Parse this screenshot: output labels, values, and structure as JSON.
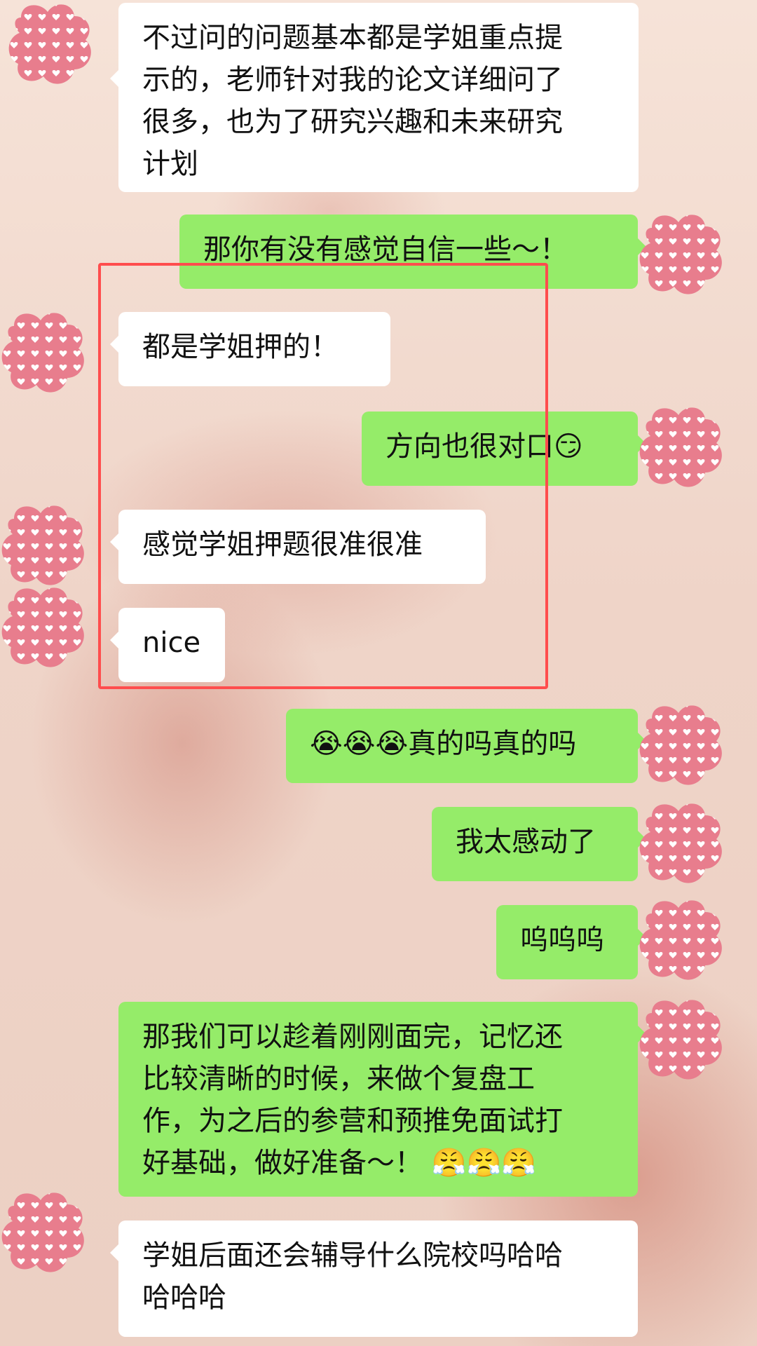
{
  "chat": {
    "messages": [
      {
        "side": "left",
        "lines": [
          "不过问的问题基本都是学姐重点提",
          "示的，老师针对我的论文详细问了",
          "很多，也为了研究兴趣和未来研究",
          "计划"
        ]
      },
      {
        "side": "right",
        "lines": [
          "那你有没有感觉自信一些～！"
        ]
      },
      {
        "side": "left",
        "lines": [
          "都是学姐押的！"
        ]
      },
      {
        "side": "right",
        "lines": [
          "方向也很对口😏"
        ]
      },
      {
        "side": "left",
        "lines": [
          "感觉学姐押题很准很准"
        ]
      },
      {
        "side": "left",
        "lines": [
          "nice"
        ]
      },
      {
        "side": "right",
        "lines": [
          "😭😭😭真的吗真的吗"
        ]
      },
      {
        "side": "right",
        "lines": [
          "我太感动了"
        ]
      },
      {
        "side": "right",
        "lines": [
          "呜呜呜"
        ]
      },
      {
        "side": "right",
        "lines": [
          "那我们可以趁着刚刚面完，记忆还",
          "比较清晰的时候，来做个复盘工",
          "作，为之后的参营和预推免面试打",
          "好基础，做好准备～！ 😤😤😤"
        ]
      },
      {
        "side": "left",
        "lines": [
          "学姐后面还会辅导什么院校吗哈哈",
          "哈哈哈"
        ]
      }
    ]
  },
  "colors": {
    "left_bubble": "#ffffff",
    "right_bubble": "#95ec69",
    "highlight_box": "#ff4d4d",
    "avatar_fill": "#e87d8d"
  }
}
